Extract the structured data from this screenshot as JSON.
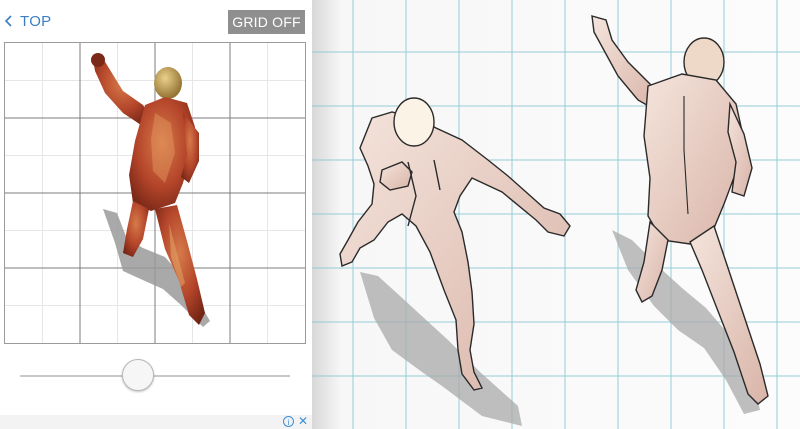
{
  "app": {
    "back_label": "TOP",
    "grid_toggle_label": "GRID OFF"
  },
  "view": {
    "rotation_slider": 0.43
  },
  "ad": {
    "info_icon": "info-icon",
    "close_icon": "close-icon",
    "info_glyph": "i",
    "close_glyph": "✕"
  },
  "colors": {
    "link_blue": "#3a7fc4",
    "button_gray": "#8f8f8f",
    "grid_line": "#8cc8d4",
    "muscle_red": "#b4452a",
    "skin_tone": "#efd6cc"
  }
}
